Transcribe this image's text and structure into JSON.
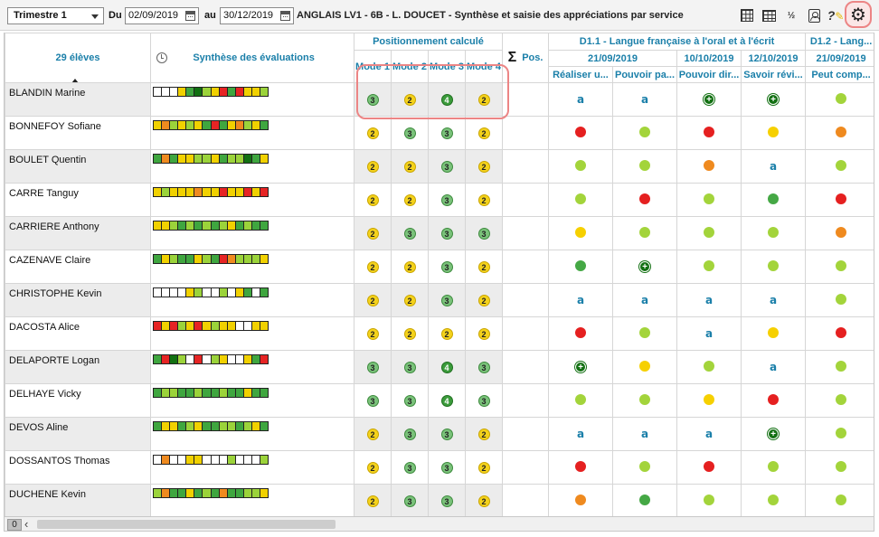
{
  "toolbar": {
    "period": "Trimestre 1",
    "du_label": "Du",
    "date_from": "02/09/2019",
    "au_label": "au",
    "date_to": "30/12/2019",
    "title": "ANGLAIS LV1 - 6B - L. DOUCET - Synthèse et saisie des appréciations par service"
  },
  "header": {
    "students_count": "29 élèves",
    "synthesis": "Synthèse des évaluations",
    "positioning": "Positionnement calculé",
    "modes": [
      "Mode 1",
      "Mode 2",
      "Mode 3",
      "Mode 4"
    ],
    "pos_label": "Pos.",
    "domain1": "D1.1 - Langue française à l'oral et à l'écrit",
    "domain2": "D1.2 - Lang...",
    "dates": [
      "21/09/2019",
      "10/10/2019",
      "12/10/2019",
      "21/09/2019"
    ],
    "criteria": [
      "Réaliser u...",
      "Pouvoir pa...",
      "Pouvoir dir...",
      "Savoir révi...",
      "Peut comp..."
    ]
  },
  "students": [
    {
      "name": "BLANDIN Marine",
      "squares": [
        "w",
        "w",
        "w",
        "y",
        "g",
        "dg",
        "lg",
        "y",
        "r",
        "g",
        "r",
        "y",
        "y",
        "lg"
      ],
      "modes": [
        3,
        2,
        4,
        2
      ],
      "crit": [
        "a",
        "a",
        "p",
        "p",
        "lg"
      ]
    },
    {
      "name": "BONNEFOY Sofiane",
      "squares": [
        "y",
        "o",
        "lg",
        "y",
        "lg",
        "y",
        "g",
        "r",
        "g",
        "y",
        "o",
        "lg",
        "y",
        "g"
      ],
      "modes": [
        2,
        3,
        3,
        2
      ],
      "crit": [
        "r",
        "lg",
        "r",
        "y",
        "o"
      ]
    },
    {
      "name": "BOULET Quentin",
      "squares": [
        "g",
        "o",
        "g",
        "y",
        "y",
        "lg",
        "lg",
        "y",
        "g",
        "lg",
        "lg",
        "dg",
        "g",
        "y"
      ],
      "modes": [
        2,
        2,
        3,
        2
      ],
      "crit": [
        "lg",
        "lg",
        "o",
        "a",
        "lg"
      ]
    },
    {
      "name": "CARRE Tanguy",
      "squares": [
        "y",
        "lg",
        "y",
        "y",
        "y",
        "o",
        "y",
        "y",
        "r",
        "y",
        "y",
        "r",
        "y",
        "r"
      ],
      "modes": [
        2,
        2,
        3,
        2
      ],
      "crit": [
        "lg",
        "r",
        "lg",
        "g",
        "r"
      ]
    },
    {
      "name": "CARRIERE Anthony",
      "squares": [
        "y",
        "y",
        "lg",
        "g",
        "lg",
        "g",
        "lg",
        "g",
        "lg",
        "y",
        "g",
        "lg",
        "g",
        "g"
      ],
      "modes": [
        2,
        3,
        3,
        3
      ],
      "crit": [
        "y",
        "lg",
        "lg",
        "lg",
        "o"
      ]
    },
    {
      "name": "CAZENAVE Claire",
      "squares": [
        "g",
        "y",
        "lg",
        "g",
        "g",
        "y",
        "lg",
        "g",
        "r",
        "o",
        "lg",
        "lg",
        "lg",
        "y"
      ],
      "modes": [
        2,
        2,
        3,
        2
      ],
      "crit": [
        "g",
        "p",
        "lg",
        "lg",
        "lg"
      ]
    },
    {
      "name": "CHRISTOPHE Kevin",
      "squares": [
        "w",
        "w",
        "w",
        "w",
        "y",
        "lg",
        "w",
        "w",
        "lg",
        "w",
        "y",
        "g",
        "w",
        "g"
      ],
      "modes": [
        2,
        2,
        3,
        2
      ],
      "crit": [
        "a",
        "a",
        "a",
        "a",
        "lg"
      ]
    },
    {
      "name": "DACOSTA Alice",
      "squares": [
        "r",
        "y",
        "r",
        "lg",
        "y",
        "r",
        "y",
        "lg",
        "y",
        "y",
        "w",
        "w",
        "y",
        "y"
      ],
      "modes": [
        2,
        2,
        2,
        2
      ],
      "crit": [
        "r",
        "lg",
        "a",
        "y",
        "r"
      ]
    },
    {
      "name": "DELAPORTE Logan",
      "squares": [
        "g",
        "r",
        "dg",
        "lg",
        "w",
        "r",
        "w",
        "lg",
        "y",
        "w",
        "w",
        "y",
        "g",
        "r"
      ],
      "modes": [
        3,
        3,
        4,
        3
      ],
      "crit": [
        "p",
        "y",
        "lg",
        "a",
        "lg"
      ]
    },
    {
      "name": "DELHAYE Vicky",
      "squares": [
        "g",
        "lg",
        "lg",
        "g",
        "g",
        "lg",
        "g",
        "g",
        "lg",
        "g",
        "g",
        "y",
        "g",
        "g"
      ],
      "modes": [
        3,
        3,
        4,
        3
      ],
      "crit": [
        "lg",
        "lg",
        "y",
        "r",
        "lg"
      ]
    },
    {
      "name": "DEVOS Aline",
      "squares": [
        "g",
        "y",
        "y",
        "g",
        "lg",
        "y",
        "g",
        "g",
        "lg",
        "lg",
        "g",
        "lg",
        "y",
        "g"
      ],
      "modes": [
        2,
        3,
        3,
        2
      ],
      "crit": [
        "a",
        "a",
        "a",
        "p",
        "lg"
      ]
    },
    {
      "name": "DOSSANTOS Thomas",
      "squares": [
        "w",
        "o",
        "w",
        "w",
        "y",
        "y",
        "w",
        "w",
        "w",
        "lg",
        "w",
        "w",
        "w",
        "lg"
      ],
      "modes": [
        2,
        3,
        3,
        2
      ],
      "crit": [
        "r",
        "lg",
        "r",
        "lg",
        "lg"
      ]
    },
    {
      "name": "DUCHENE Kevin",
      "squares": [
        "lg",
        "o",
        "g",
        "g",
        "y",
        "g",
        "lg",
        "g",
        "o",
        "g",
        "g",
        "lg",
        "lg",
        "y"
      ],
      "modes": [
        2,
        3,
        3,
        2
      ],
      "crit": [
        "o",
        "g",
        "lg",
        "lg",
        "lg"
      ]
    }
  ],
  "footer": {
    "count": "0"
  }
}
